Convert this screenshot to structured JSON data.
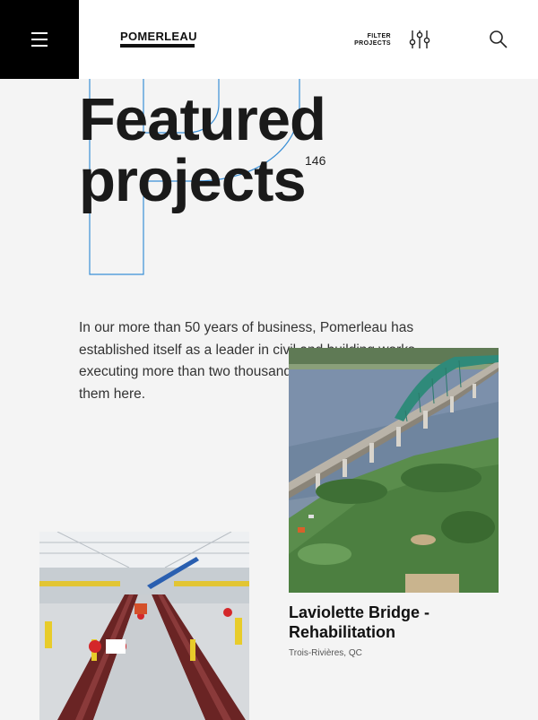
{
  "header": {
    "logo_text": "POMERLEAU",
    "filter_line1": "FILTER",
    "filter_line2": "PROJECTS"
  },
  "hero": {
    "title_line1": "Featured",
    "title_line2": "projects",
    "count": "146"
  },
  "intro": {
    "text": "In our more than 50 years of business, Pomerleau has established itself as a leader in civil and building works, executing more than two thousand projects. Discover some of them here."
  },
  "projects": [
    {
      "title": "Laviolette Bridge - Rehabilitation",
      "location": "Trois-Rivières, QC"
    },
    {
      "title": "",
      "location": ""
    }
  ],
  "colors": {
    "menu_bg": "#000000",
    "outline_accent": "#3a8fd6",
    "page_bg": "#f4f4f4"
  }
}
